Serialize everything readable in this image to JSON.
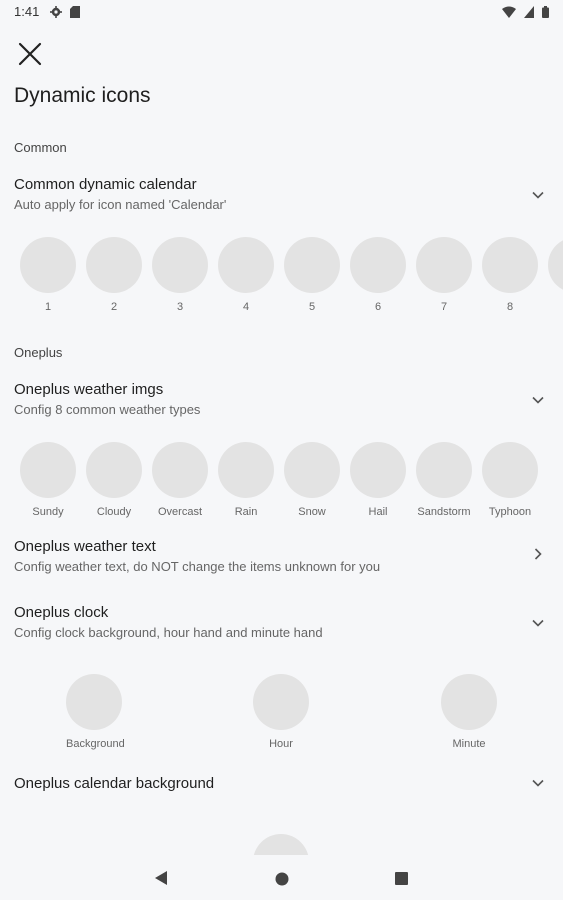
{
  "status_bar": {
    "time": "1:41"
  },
  "page": {
    "title": "Dynamic icons"
  },
  "common": {
    "section": "Common",
    "calendar": {
      "title": "Common dynamic calendar",
      "subtitle": "Auto apply for icon named 'Calendar'",
      "items": [
        "1",
        "2",
        "3",
        "4",
        "5",
        "6",
        "7",
        "8"
      ]
    }
  },
  "oneplus": {
    "section": "Oneplus",
    "weather_imgs": {
      "title": "Oneplus weather imgs",
      "subtitle": "Config 8 common weather types",
      "items": [
        "Sundy",
        "Cloudy",
        "Overcast",
        "Rain",
        "Snow",
        "Hail",
        "Sandstorm",
        "Typhoon"
      ]
    },
    "weather_text": {
      "title": "Oneplus weather text",
      "subtitle": "Config weather text, do NOT change the items unknown for you"
    },
    "clock": {
      "title": "Oneplus clock",
      "subtitle": "Config clock background, hour hand and minute hand",
      "items": [
        "Background",
        "Hour",
        "Minute"
      ]
    },
    "calendar_background": {
      "title": "Oneplus calendar background"
    }
  }
}
